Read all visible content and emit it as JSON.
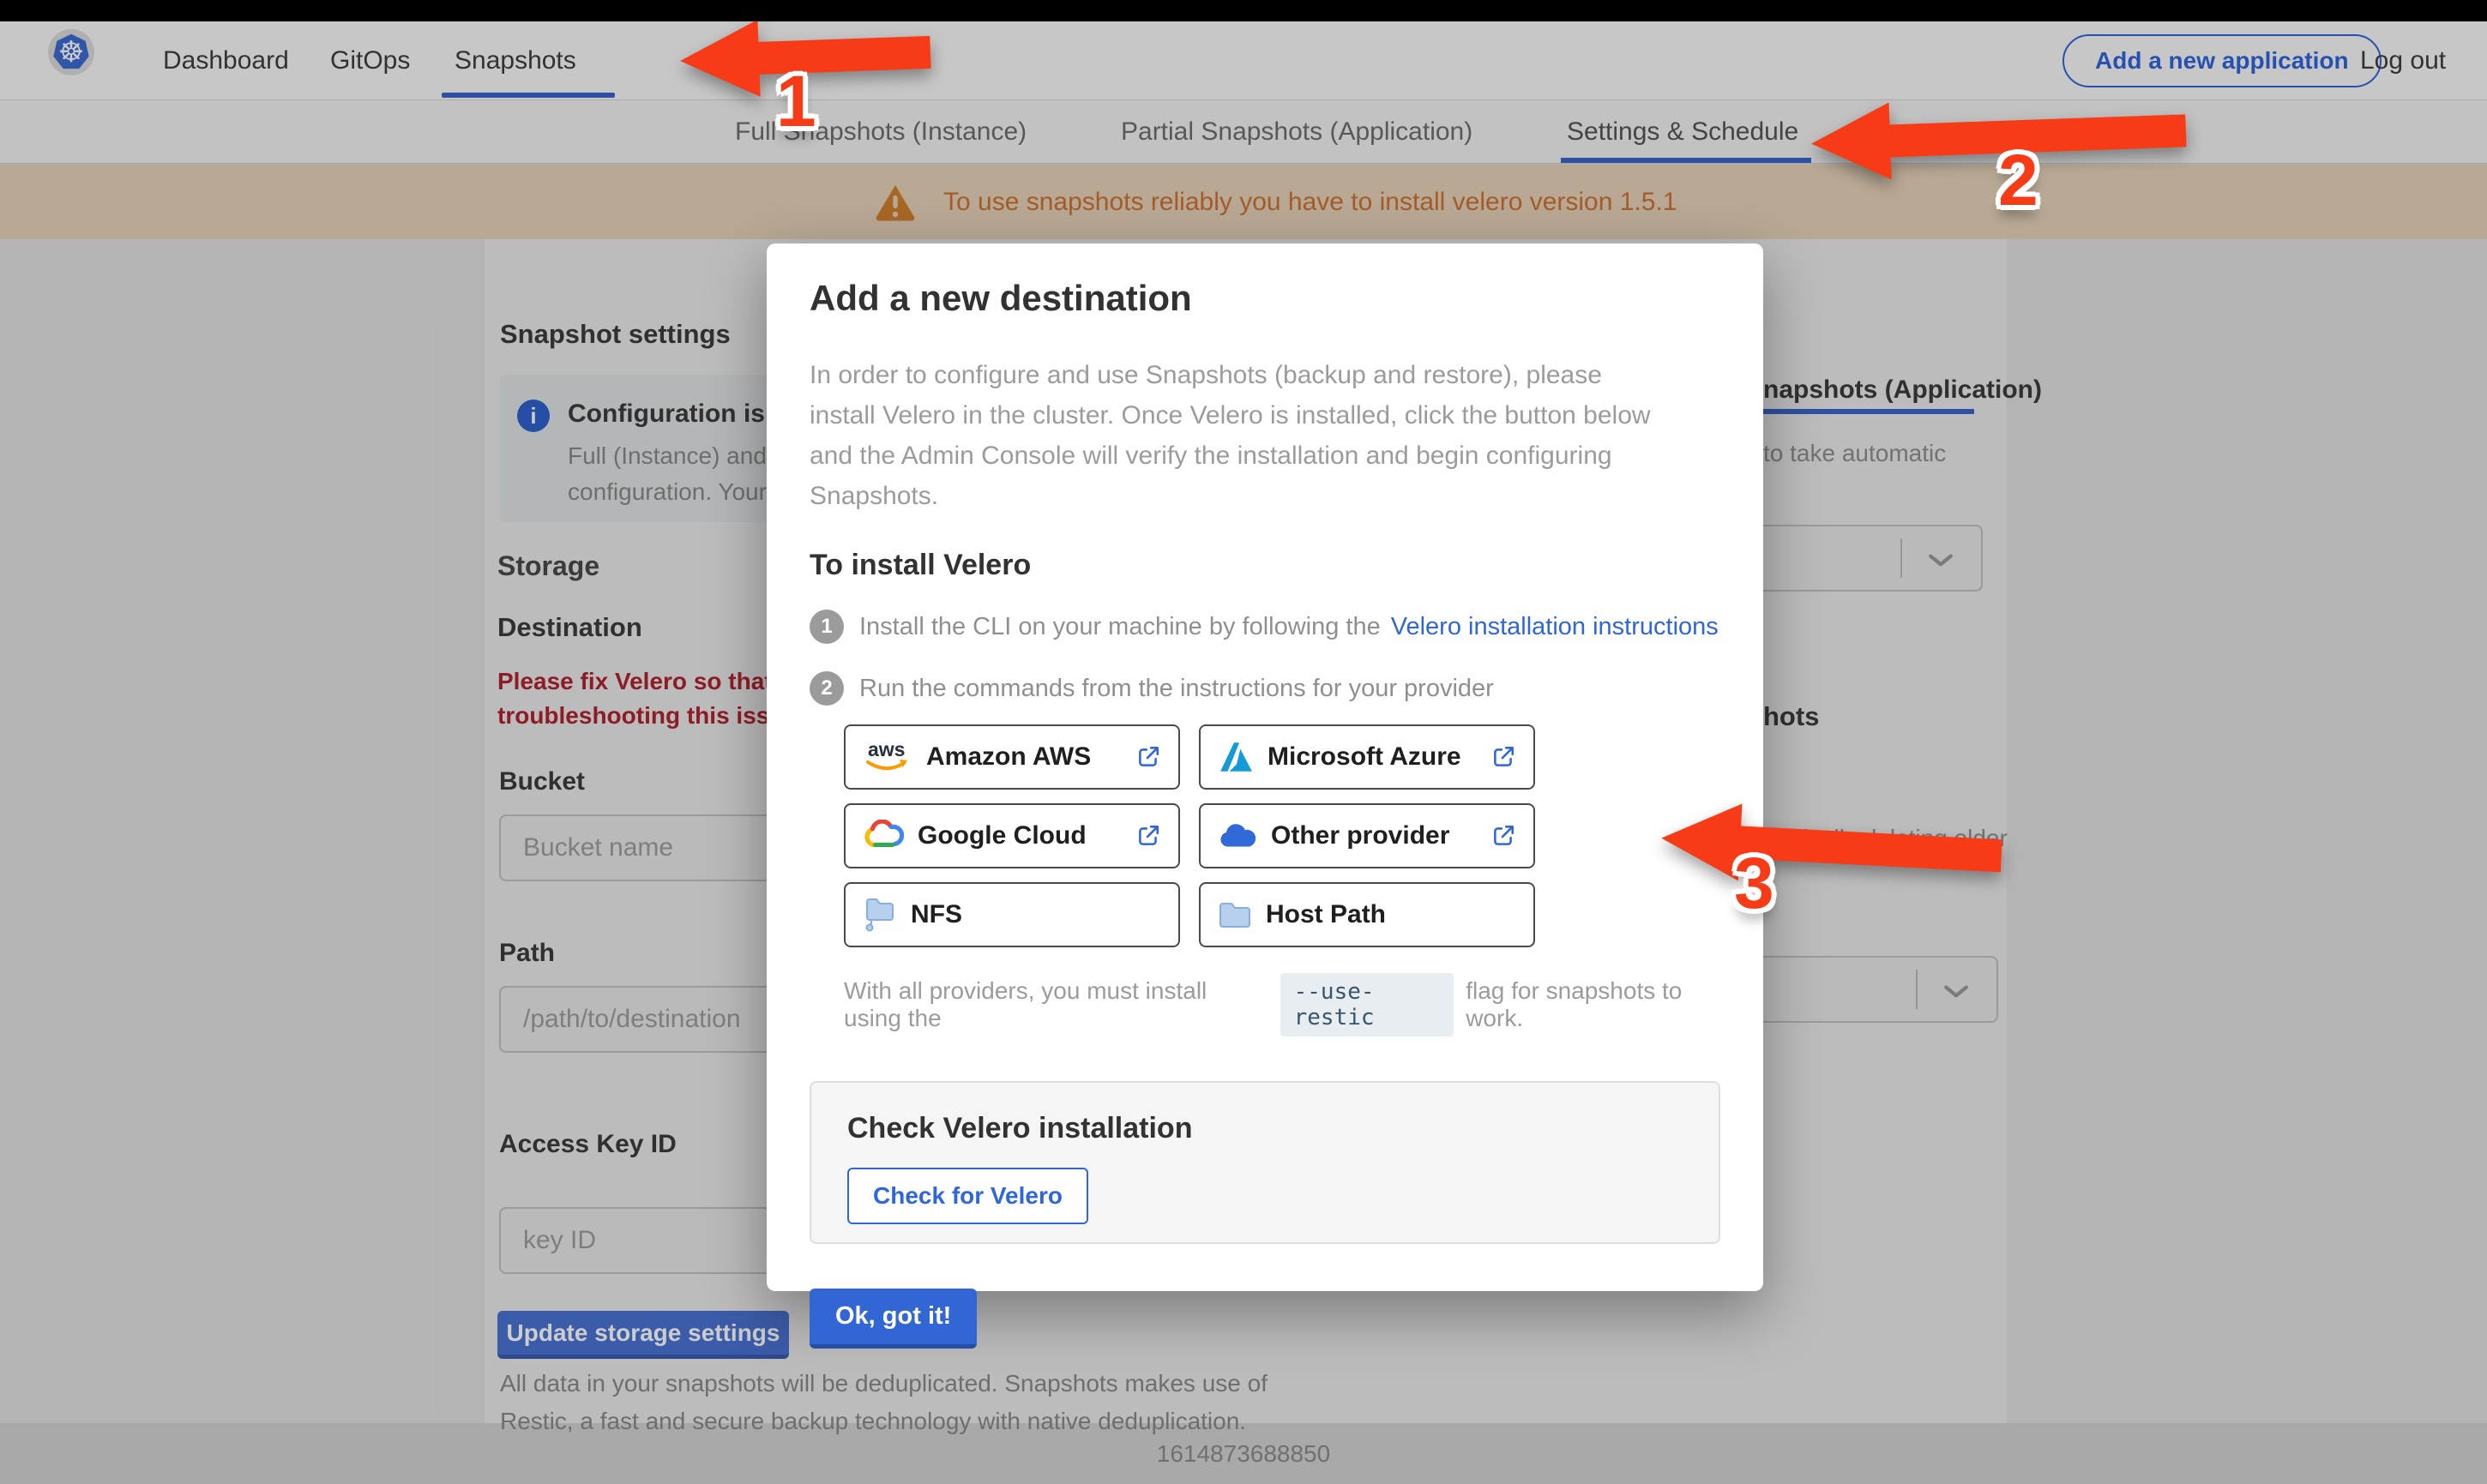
{
  "nav": {
    "items": [
      {
        "label": "Dashboard"
      },
      {
        "label": "GitOps"
      },
      {
        "label": "Snapshots"
      }
    ],
    "add_app_label": "Add a new application",
    "logout_label": "Log out"
  },
  "tabs": [
    {
      "label": "Full Snapshots (Instance)"
    },
    {
      "label": "Partial Snapshots (Application)"
    },
    {
      "label": "Settings & Schedule"
    }
  ],
  "banner": {
    "text": "To use snapshots reliably you have to install velero version 1.5.1"
  },
  "settings_page": {
    "title": "Snapshot settings",
    "config_notice_bold": "Configuration is sh",
    "config_notice_line2": "Full (Instance) and Parti",
    "config_notice_line3": "configuration. Your stor",
    "storage_heading": "Storage",
    "destination_heading": "Destination",
    "error_line1": "Please fix Velero so that th",
    "error_line2": "troubleshooting this issue",
    "bucket_label": "Bucket",
    "bucket_placeholder": "Bucket name",
    "path_label": "Path",
    "path_placeholder": "/path/to/destination",
    "access_key_label": "Access Key ID",
    "access_key_placeholder": "key ID",
    "update_button": "Update storage settings",
    "note_line1": "All data in your snapshots will be deduplicated. Snapshots makes use of",
    "note_line2": "Restic, a fast and secure backup technology with native deduplication.",
    "right_tab_fragment": "napshots (Application)",
    "right_fragment1": "to take automatic",
    "right_fragment2": "hots",
    "right_fragment3": "matically deleting older"
  },
  "modal": {
    "title": "Add a new destination",
    "lede": "In order to configure and use Snapshots (backup and restore), please install Velero in the cluster. Once Velero is installed, click the button below and the Admin Console will verify the installation and begin configuring Snapshots.",
    "install_heading": "To install Velero",
    "step1_num": "1",
    "step1_text": "Install the CLI on your machine by following the",
    "step1_link": "Velero installation instructions",
    "step2_num": "2",
    "step2_text": "Run the commands from the instructions for your provider",
    "providers": [
      {
        "label": "Amazon AWS",
        "icon": "aws-icon",
        "external": true
      },
      {
        "label": "Microsoft Azure",
        "icon": "azure-icon",
        "external": true
      },
      {
        "label": "Google Cloud",
        "icon": "google-cloud-icon",
        "external": true
      },
      {
        "label": "Other provider",
        "icon": "cloud-icon",
        "external": true
      },
      {
        "label": "NFS",
        "icon": "folder-network-icon",
        "external": false
      },
      {
        "label": "Host Path",
        "icon": "folder-icon",
        "external": false
      }
    ],
    "restic_prefix": "With all providers, you must install using the",
    "restic_code": "--use-restic",
    "restic_suffix": "flag for snapshots to work.",
    "check_heading": "Check Velero installation",
    "check_button": "Check for Velero",
    "ok_button": "Ok, got it!"
  },
  "footer": {
    "timestamp": "1614873688850"
  },
  "annotations": {
    "num1": "1",
    "num2": "2",
    "num3": "3"
  },
  "colors": {
    "accent_blue": "#3066dc",
    "arrow_red": "#f63b16",
    "banner_orange": "#cf7434",
    "error_red": "#b22430",
    "kubernetes_blue": "#3b6cd4"
  },
  "icons": [
    "kubernetes-logo-icon",
    "info-icon",
    "warning-icon",
    "external-link-icon",
    "chevron-down-icon",
    "aws-icon",
    "azure-icon",
    "google-cloud-icon",
    "cloud-icon",
    "folder-network-icon",
    "folder-icon"
  ]
}
